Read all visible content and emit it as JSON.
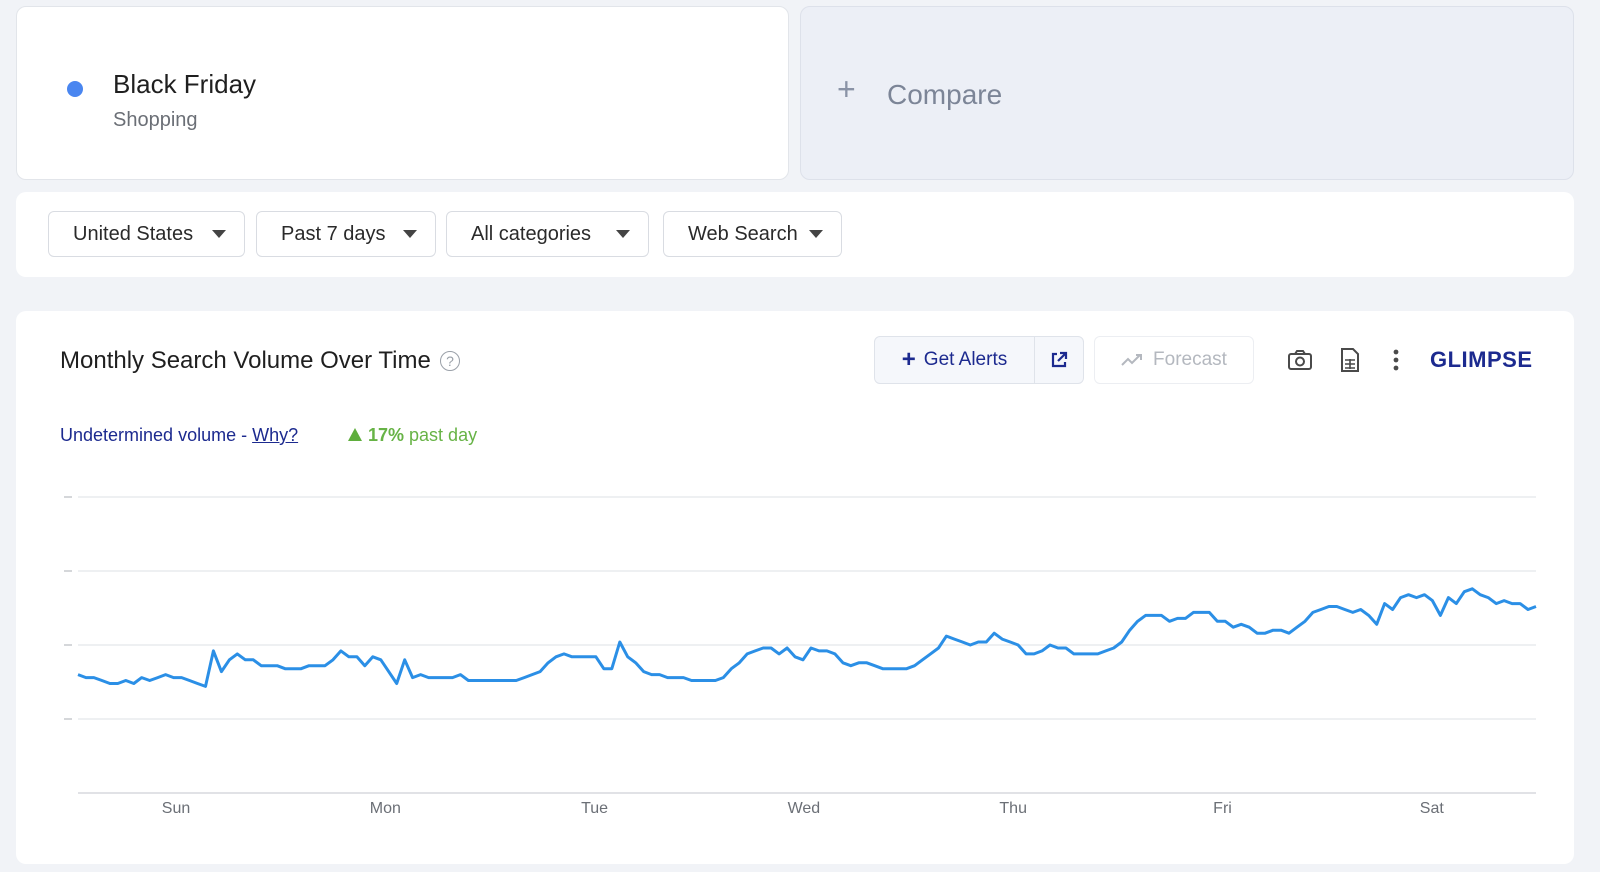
{
  "term": {
    "title": "Black Friday",
    "category": "Shopping",
    "color": "#4a86f0"
  },
  "compare": {
    "label": "Compare",
    "icon": "plus-icon"
  },
  "filters": [
    {
      "label": "United States"
    },
    {
      "label": "Past 7 days"
    },
    {
      "label": "All categories"
    },
    {
      "label": "Web Search"
    }
  ],
  "chart_panel": {
    "title": "Monthly Search Volume Over Time",
    "get_alerts_label": "Get Alerts",
    "forecast_label": "Forecast",
    "brand": "GLIMPSE",
    "volume_text": "Undetermined volume - ",
    "why_link": "Why?",
    "change_value": "17%",
    "change_text": " past day",
    "accent": "#1c2a8f",
    "positive_color": "#67b346",
    "line_color": "#2b8fe6"
  },
  "chart_data": {
    "type": "line",
    "xlabel": "",
    "ylabel": "",
    "x_ticks": [
      "Sun",
      "Mon",
      "Tue",
      "Wed",
      "Thu",
      "Fri",
      "Sat"
    ],
    "ylim": [
      0,
      100
    ],
    "gridlines": 4,
    "grid": true,
    "series": [
      {
        "values": [
          40,
          39,
          39,
          38,
          37,
          37,
          38,
          37,
          39,
          38,
          39,
          40,
          39,
          39,
          38,
          37,
          36,
          48,
          41,
          45,
          47,
          45,
          45,
          43,
          43,
          43,
          42,
          42,
          42,
          43,
          43,
          43,
          45,
          48,
          46,
          46,
          43,
          46,
          45,
          41,
          37,
          45,
          39,
          40,
          39,
          39,
          39,
          39,
          40,
          38,
          38,
          38,
          38,
          38,
          38,
          38,
          39,
          40,
          41,
          44,
          46,
          47,
          46,
          46,
          46,
          46,
          42,
          42,
          51,
          46,
          44,
          41,
          40,
          40,
          39,
          39,
          39,
          38,
          38,
          38,
          38,
          39,
          42,
          44,
          47,
          48,
          49,
          49,
          47,
          49,
          46,
          45,
          49,
          48,
          48,
          47,
          44,
          43,
          44,
          44,
          43,
          42,
          42,
          42,
          42,
          43,
          45,
          47,
          49,
          53,
          52,
          51,
          50,
          51,
          51,
          54,
          52,
          51,
          50,
          47,
          47,
          48,
          50,
          49,
          49,
          47,
          47,
          47,
          47,
          48,
          49,
          51,
          55,
          58,
          60,
          60,
          60,
          58,
          59,
          59,
          61,
          61,
          61,
          58,
          58,
          56,
          57,
          56,
          54,
          54,
          55,
          55,
          54,
          56,
          58,
          61,
          62,
          63,
          63,
          62,
          61,
          62,
          60,
          57,
          64,
          62,
          66,
          67,
          66,
          67,
          65,
          60,
          66,
          64,
          68,
          69,
          67,
          66,
          64,
          65,
          64,
          64,
          62,
          63
        ],
        "color": "#2b8fe6"
      }
    ]
  }
}
